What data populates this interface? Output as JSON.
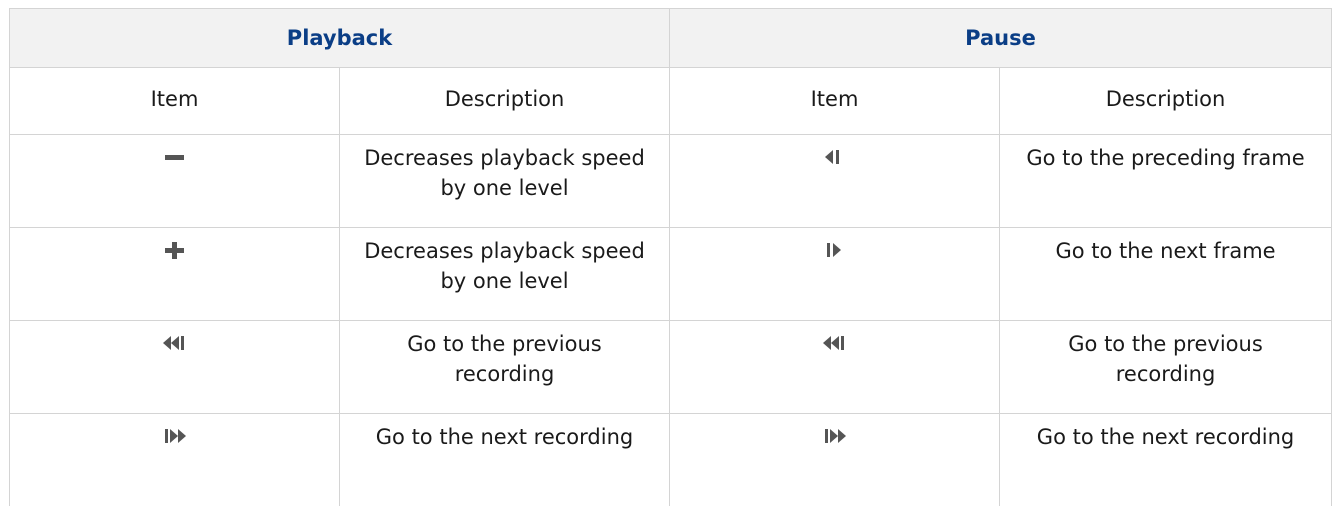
{
  "header": {
    "playback": "Playback",
    "pause": "Pause"
  },
  "subheader": {
    "item": "Item",
    "description": "Description"
  },
  "playback_rows": [
    {
      "icon": "minus-icon",
      "description": "Decreases playback speed by one level"
    },
    {
      "icon": "plus-icon",
      "description": "Decreases playback speed by one level"
    },
    {
      "icon": "previous-recording-icon",
      "description": "Go to the previous recording"
    },
    {
      "icon": "next-recording-icon",
      "description": "Go to the next recording"
    }
  ],
  "pause_rows": [
    {
      "icon": "previous-frame-icon",
      "description": "Go to the preceding frame"
    },
    {
      "icon": "next-frame-icon",
      "description": "Go to the next frame"
    },
    {
      "icon": "previous-recording-icon",
      "description": "Go to the previous recording"
    },
    {
      "icon": "next-recording-icon",
      "description": "Go to the next recording"
    }
  ],
  "colors": {
    "header_text": "#0b3e86",
    "header_background": "#f2f2f2",
    "border": "#d4d4d4",
    "icon": "#4a4a4a"
  }
}
